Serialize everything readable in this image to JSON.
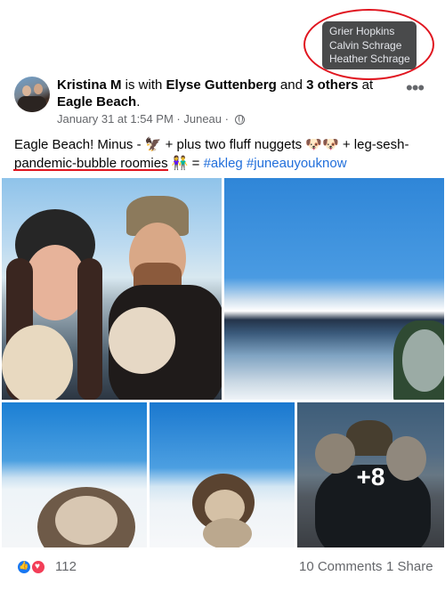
{
  "tooltip": {
    "names": [
      "Grier Hopkins",
      "Calvin Schrage",
      "Heather Schrage"
    ]
  },
  "post": {
    "author": "Kristina M",
    "with_word": " is with ",
    "tagged": "Elyse Guttenberg",
    "and_word": " and ",
    "others": "3 others",
    "at_word": " at ",
    "place": "Eagle Beach",
    "period": ".",
    "timestamp": "January 31 at 1:54 PM · Juneau · ",
    "text_part1": "Eagle Beach! Minus - 🦅 + plus two fluff nuggets 🐶🐶 + leg-sesh-",
    "text_underlined": "pandemic-bubble roomies",
    "text_part2": " 👫 = ",
    "hashtag1": "#akleg",
    "hashtag2": "#juneauyouknow",
    "more_photos": "+8"
  },
  "footer": {
    "reaction_count": "112",
    "comments": "10 Comments",
    "shares": "1 Share"
  },
  "icons": [
    "like-reaction-icon",
    "love-reaction-icon",
    "globe-icon",
    "more-options-icon"
  ],
  "colors": {
    "link": "#216fdb",
    "annotation": "#e0151f",
    "like": "#1877f2",
    "love": "#f33e58"
  }
}
